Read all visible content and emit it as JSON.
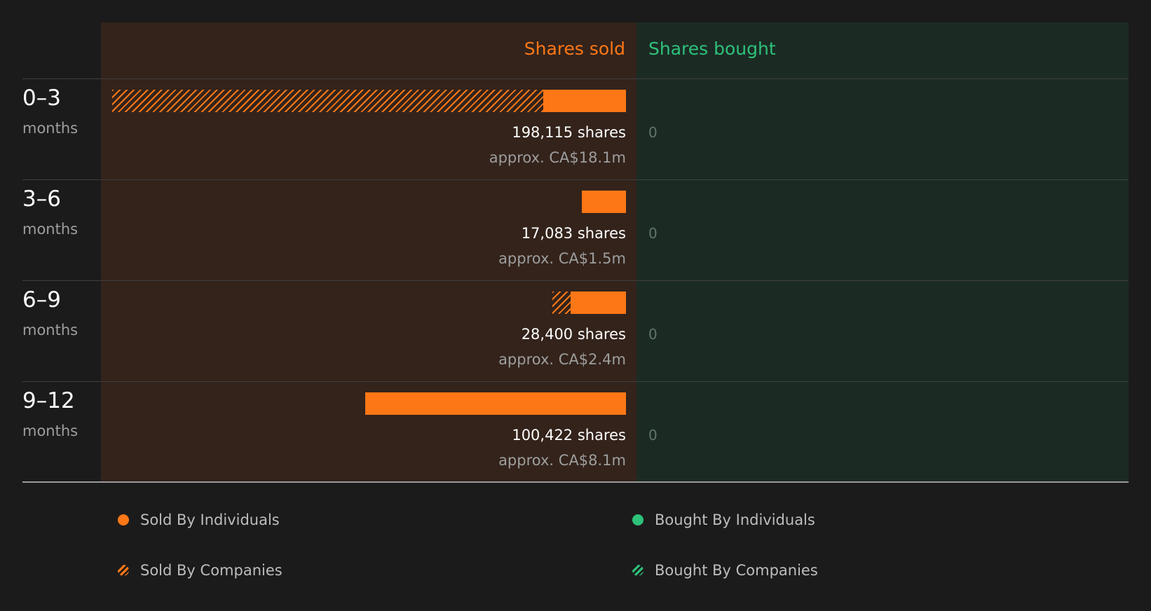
{
  "colors": {
    "sold": "#fe7716",
    "bought": "#2ec17a",
    "sold_bg": "#33231b",
    "bought_bg": "#1b2b24",
    "background": "#1b1b1b"
  },
  "chart_data": {
    "type": "bar",
    "orientation": "horizontal",
    "layout": "diverging",
    "headers": {
      "sold": "Shares sold",
      "bought": "Shares bought"
    },
    "categories": [
      {
        "period": "0–3",
        "unit": "months",
        "sold_label": "198,115 shares",
        "sold_value_label": "approx. CA$18.1m",
        "bought_label": "0"
      },
      {
        "period": "3–6",
        "unit": "months",
        "sold_label": "17,083 shares",
        "sold_value_label": "approx. CA$1.5m",
        "bought_label": "0"
      },
      {
        "period": "6–9",
        "unit": "months",
        "sold_label": "28,400 shares",
        "sold_value_label": "approx. CA$2.4m",
        "bought_label": "0"
      },
      {
        "period": "9–12",
        "unit": "months",
        "sold_label": "100,422 shares",
        "sold_value_label": "approx. CA$8.1m",
        "bought_label": "0"
      }
    ],
    "series": [
      {
        "name": "Sold By Individuals",
        "side": "sold",
        "pattern": "solid",
        "values": [
          31900,
          17083,
          21400,
          100422
        ]
      },
      {
        "name": "Sold By Companies",
        "side": "sold",
        "pattern": "hatched",
        "values": [
          166215,
          0,
          7000,
          0
        ]
      },
      {
        "name": "Bought By Individuals",
        "side": "bought",
        "pattern": "solid",
        "values": [
          0,
          0,
          0,
          0
        ]
      },
      {
        "name": "Bought By Companies",
        "side": "bought",
        "pattern": "hatched",
        "values": [
          0,
          0,
          0,
          0
        ]
      }
    ],
    "xlim": [
      0,
      198115
    ]
  },
  "legend": [
    {
      "label": "Sold By Individuals",
      "icon": "solid-dot-orange"
    },
    {
      "label": "Bought By Individuals",
      "icon": "solid-dot-green"
    },
    {
      "label": "Sold By Companies",
      "icon": "hatched-dot-orange"
    },
    {
      "label": "Bought By Companies",
      "icon": "hatched-dot-green"
    }
  ]
}
